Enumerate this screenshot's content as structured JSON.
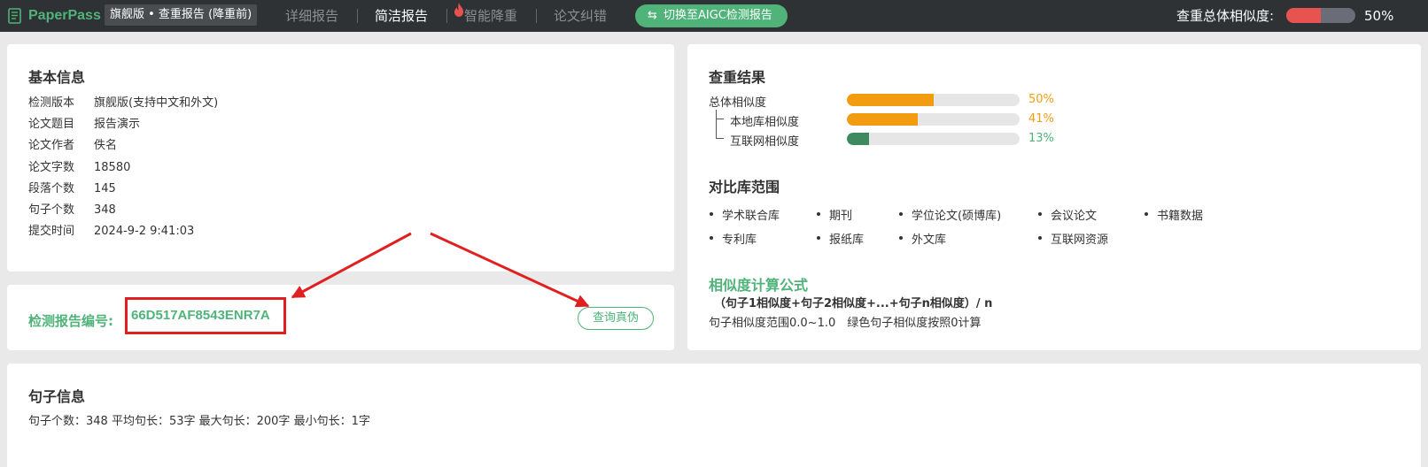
{
  "topbar": {
    "app_name": "PaperPass",
    "edition": "旗舰版 • 查重报告 (降重前)",
    "nav": {
      "detail_report": "详细报告",
      "brief_report": "简洁报告",
      "smart_rewrite": "智能降重",
      "error_check": "论文纠错"
    },
    "aigc_button": "切换至AIGC检测报告",
    "overall_label": "查重总体相似度:",
    "overall_value": 0.5,
    "overall_pct": "50%"
  },
  "basic_info": {
    "title": "基本信息",
    "rows": [
      {
        "key": "检测版本",
        "value": "旗舰版(支持中文和外文)"
      },
      {
        "key": "论文题目",
        "value": "报告演示"
      },
      {
        "key": "论文作者",
        "value": "佚名"
      },
      {
        "key": "论文字数",
        "value": "18580"
      },
      {
        "key": "段落个数",
        "value": "145"
      },
      {
        "key": "句子个数",
        "value": "348"
      },
      {
        "key": "提交时间",
        "value": "2024-9-2 9:41:03"
      }
    ]
  },
  "report": {
    "label": "检测报告编号:",
    "number": "66D517AF8543ENR7A",
    "verify_button": "查询真伪"
  },
  "results": {
    "title": "查重结果",
    "rows": [
      {
        "label": "总体相似度",
        "value": 0.5,
        "pct": "50%",
        "color": "#f29c11"
      },
      {
        "label": "本地库相似度",
        "value": 0.41,
        "pct": "41%",
        "color": "#f29c11"
      },
      {
        "label": "互联网相似度",
        "value": 0.13,
        "pct": "13%",
        "color": "#3e8a5e",
        "pct_color": "#4fb37a"
      }
    ]
  },
  "scope": {
    "title": "对比库范围",
    "items": [
      "学术联合库",
      "期刊",
      "学位论文(硕博库)",
      "会议论文",
      "书籍数据",
      "专利库",
      "报纸库",
      "外文库",
      "互联网资源"
    ]
  },
  "formula": {
    "title": "相似度计算公式",
    "text": "（句子1相似度+句子2相似度+...+句子n相似度）/ n",
    "note": "句子相似度范围0.0~1.0　绿色句子相似度按照0计算"
  },
  "sentence_info": {
    "title": "句子信息",
    "stats": "句子个数：348 平均句长：53字 最大句长：200字 最小句长：1字"
  },
  "colors": {
    "brand_green": "#4fb37a",
    "topbar_bg": "#2f3234",
    "orange": "#f29c11",
    "red_highlight": "#e02020"
  }
}
